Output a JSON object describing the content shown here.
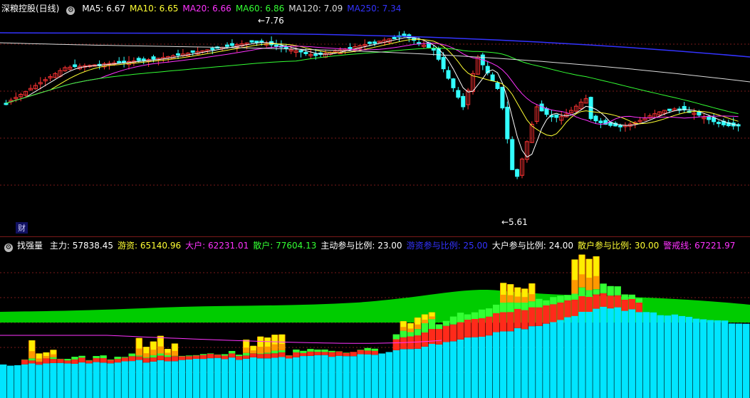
{
  "top_panel": {
    "title": "深粮控股(日线)",
    "indicators": [
      {
        "label": "MA5: 6.67",
        "color": "#ffffff"
      },
      {
        "label": "MA10: 6.65",
        "color": "#ffff33"
      },
      {
        "label": "MA20: 6.66",
        "color": "#ff33ff"
      },
      {
        "label": "MA60: 6.86",
        "color": "#33ff33"
      },
      {
        "label": "MA120: 7.09",
        "color": "#dddddd"
      },
      {
        "label": "MA250: 7.34",
        "color": "#3333ff"
      }
    ],
    "high_label": "7.76",
    "low_label": "5.61",
    "badge": "财"
  },
  "bottom_panel": {
    "title": "找强量",
    "indicators": [
      {
        "label": "主力: 57838.45",
        "color": "#ffffff"
      },
      {
        "label": "游资: 65140.96",
        "color": "#ffff33"
      },
      {
        "label": "大户: 62231.01",
        "color": "#ff33ff"
      },
      {
        "label": "散户: 77604.13",
        "color": "#33ff33"
      },
      {
        "label": "主动参与比例: 23.00",
        "color": "#ffffff"
      },
      {
        "label": "游资参与比例: 25.00",
        "color": "#3333ff"
      },
      {
        "label": "大户参与比例: 24.00",
        "color": "#ffffff"
      },
      {
        "label": "散户参与比例: 30.00",
        "color": "#ffff33"
      },
      {
        "label": "警戒线: 67221.97",
        "color": "#ff33ff"
      }
    ]
  },
  "colors": {
    "up": "#ff3333",
    "down": "#33ffff",
    "grid": "#7a1a1a",
    "cyan_volume": "#00e5ff",
    "red_volume": "#ff2a1a",
    "green_volume": "#00cc00",
    "lime_volume": "#33ff33",
    "orange_volume": "#ff9900",
    "yellow_volume": "#ffee00"
  }
}
